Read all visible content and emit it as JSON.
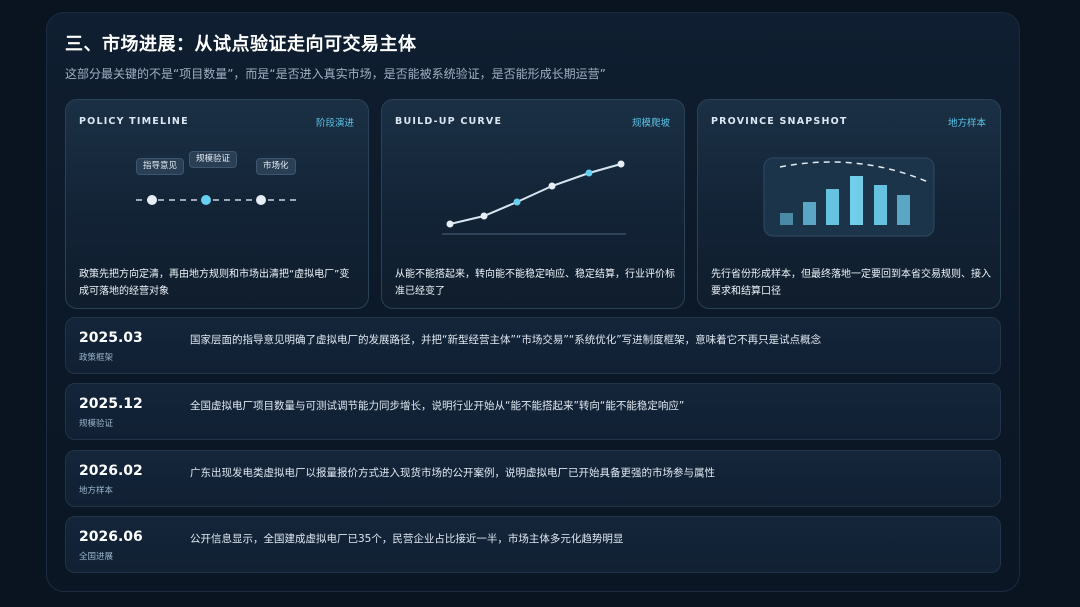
{
  "page": {
    "title": "三、市场进展：从试点验证走向可交易主体",
    "subtitle": "这部分最关键的不是“项目数量”，而是“是否进入真实市场，是否能被系统验证，是否能形成长期运营”"
  },
  "cards": [
    {
      "tag": "POLICY TIMELINE",
      "link": "阶段演进",
      "chips": [
        "指导意见",
        "规模验证",
        "市场化"
      ],
      "desc": "政策先把方向定清，再由地方规则和市场出清把“虚拟电厂”变成可落地的经营对象"
    },
    {
      "tag": "BUILD-UP CURVE",
      "link": "规模爬坡",
      "desc": "从能不能搭起来，转向能不能稳定响应、稳定结算，行业评价标准已经变了"
    },
    {
      "tag": "PROVINCE SNAPSHOT",
      "link": "地方样本",
      "desc": "先行省份形成样本，但最终落地一定要回到本省交易规则、接入要求和结算口径"
    }
  ],
  "timeline": [
    {
      "date": "2025.03",
      "tag": "政策框架",
      "text": "国家层面的指导意见明确了虚拟电厂的发展路径，并把“新型经营主体”“市场交易”“系统优化”写进制度框架，意味着它不再只是试点概念"
    },
    {
      "date": "2025.12",
      "tag": "规模验证",
      "text": "全国虚拟电厂项目数量与可测试调节能力同步增长，说明行业开始从“能不能搭起来”转向“能不能稳定响应”"
    },
    {
      "date": "2026.02",
      "tag": "地方样本",
      "text": "广东出现发电类虚拟电厂以报量报价方式进入现货市场的公开案例，说明虚拟电厂已开始具备更强的市场参与属性"
    },
    {
      "date": "2026.06",
      "tag": "全国进展",
      "text": "公开信息显示，全国建成虚拟电厂已35个，民营企业占比接近一半，市场主体多元化趋势明显"
    }
  ],
  "colors": {
    "accent": "#5bc3e6",
    "accent_bright": "#67d0f0",
    "background": "#0a1320"
  }
}
